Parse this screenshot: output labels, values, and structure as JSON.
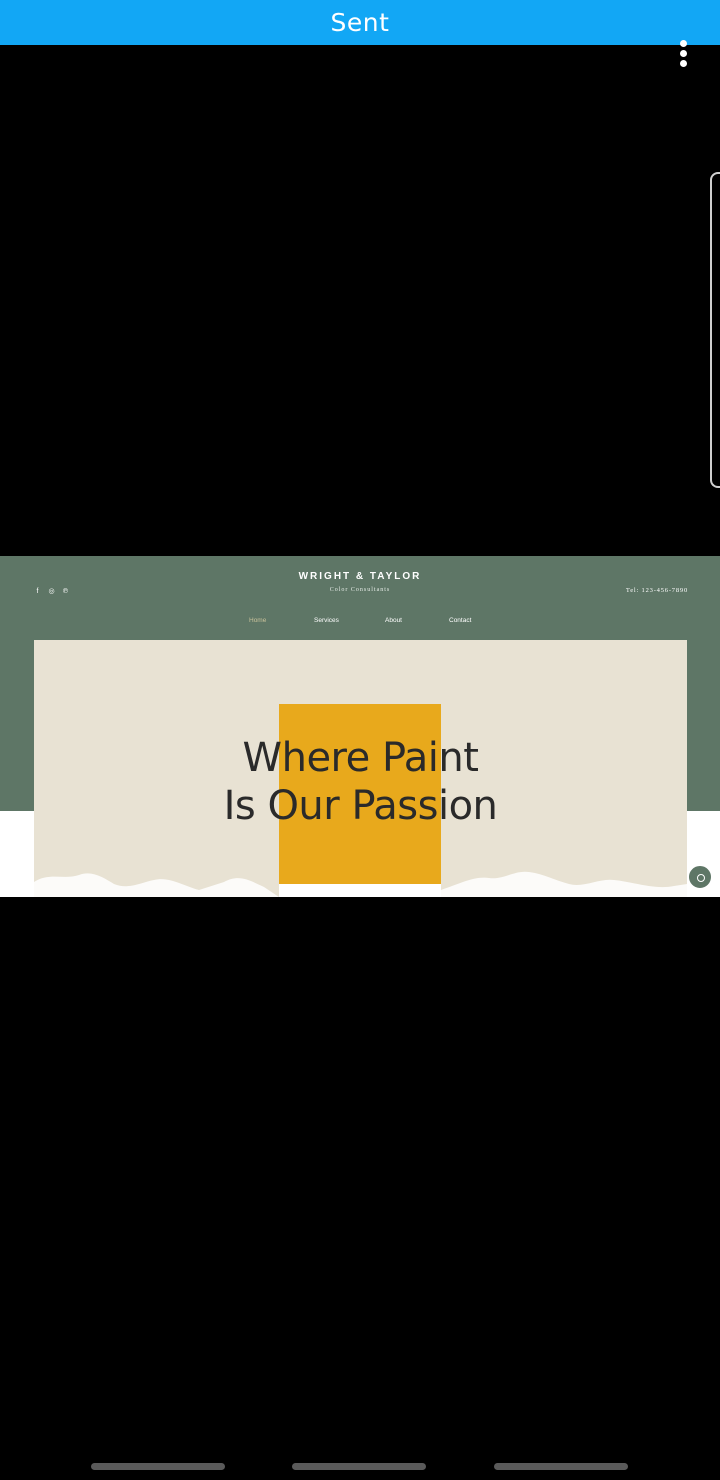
{
  "status_bar": {
    "title": "Sent"
  },
  "colors": {
    "accent_bar": "#12a7f5",
    "site_green": "#5e7666",
    "hero_cream": "#e8e2d3",
    "swatch_yellow": "#e8a91c"
  },
  "website": {
    "brand": "WRIGHT & TAYLOR",
    "tagline": "Color Consultants",
    "phone": "Tel: 123-456-7890",
    "social_icons": [
      {
        "name": "facebook-icon",
        "glyph": "f"
      },
      {
        "name": "instagram-icon",
        "glyph": "◎"
      },
      {
        "name": "pinterest-icon",
        "glyph": "℗"
      }
    ],
    "nav": [
      "Home",
      "Services",
      "About",
      "Contact"
    ],
    "active_nav": "Home",
    "headline_line1": "Where Paint",
    "headline_line2": "Is Our Passion"
  },
  "icons": {
    "menu": "more-vert-icon",
    "chat": "chat-icon"
  }
}
